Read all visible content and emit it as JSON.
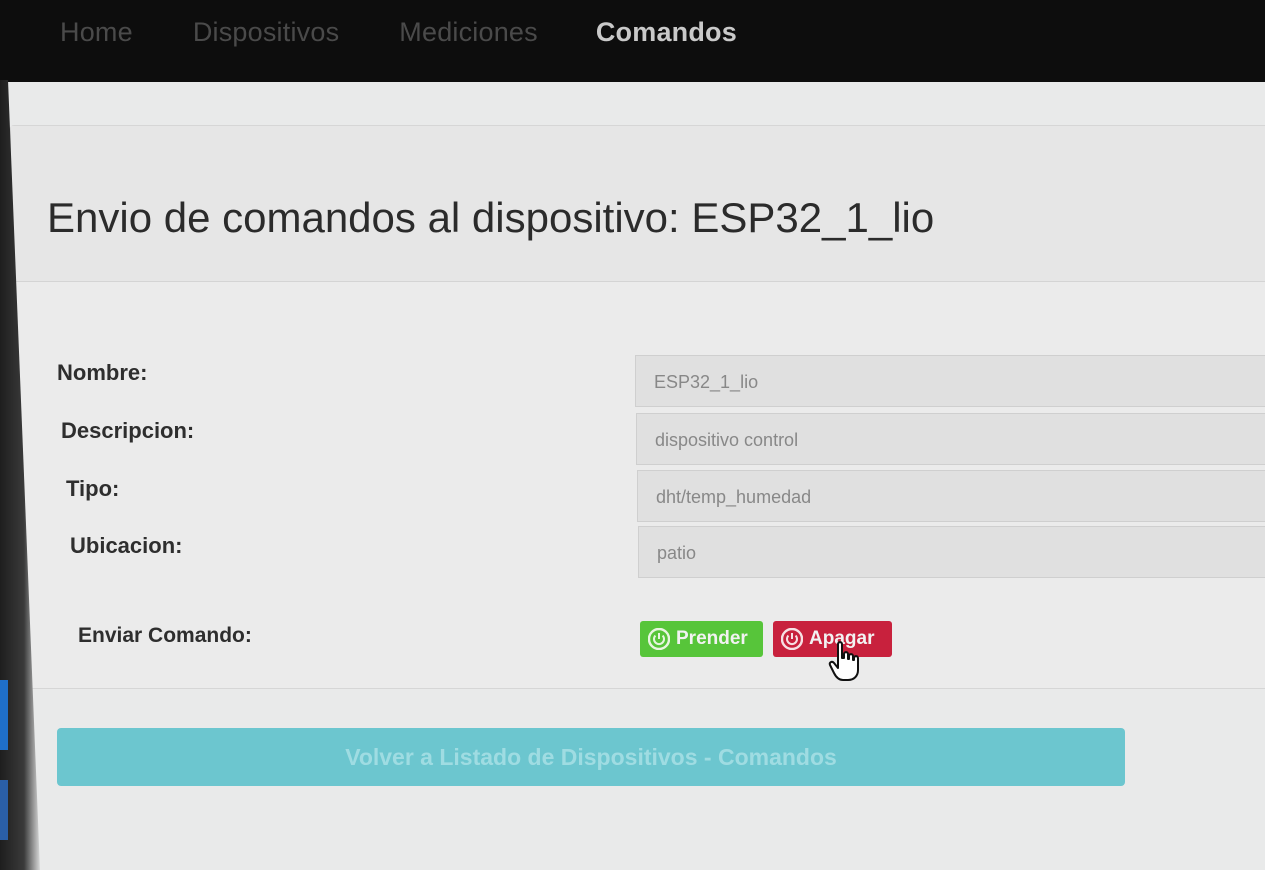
{
  "navbar": {
    "items": [
      {
        "label": "Home"
      },
      {
        "label": "Dispositivos"
      },
      {
        "label": "Mediciones"
      },
      {
        "label": "Comandos"
      }
    ]
  },
  "panel": {
    "title": "Envio de comandos al dispositivo: ESP32_1_lio"
  },
  "form": {
    "nombre": {
      "label": "Nombre:",
      "value": "ESP32_1_lio"
    },
    "descripcion": {
      "label": "Descripcion:",
      "value": "dispositivo control"
    },
    "tipo": {
      "label": "Tipo:",
      "value": "dht/temp_humedad"
    },
    "ubicacion": {
      "label": "Ubicacion:",
      "value": "patio"
    },
    "enviar": {
      "label": "Enviar Comando:"
    }
  },
  "buttons": {
    "prender": "Prender",
    "apagar": "Apagar",
    "volver": "Volver a Listado de Dispositivos - Comandos"
  },
  "colors": {
    "prender": "#57c53a",
    "apagar": "#c8213d",
    "volver": "#6cc6cf",
    "navbar": "#0d0d0d"
  },
  "icons": {
    "power": "power-icon",
    "pointer": "hand-pointer-icon"
  }
}
